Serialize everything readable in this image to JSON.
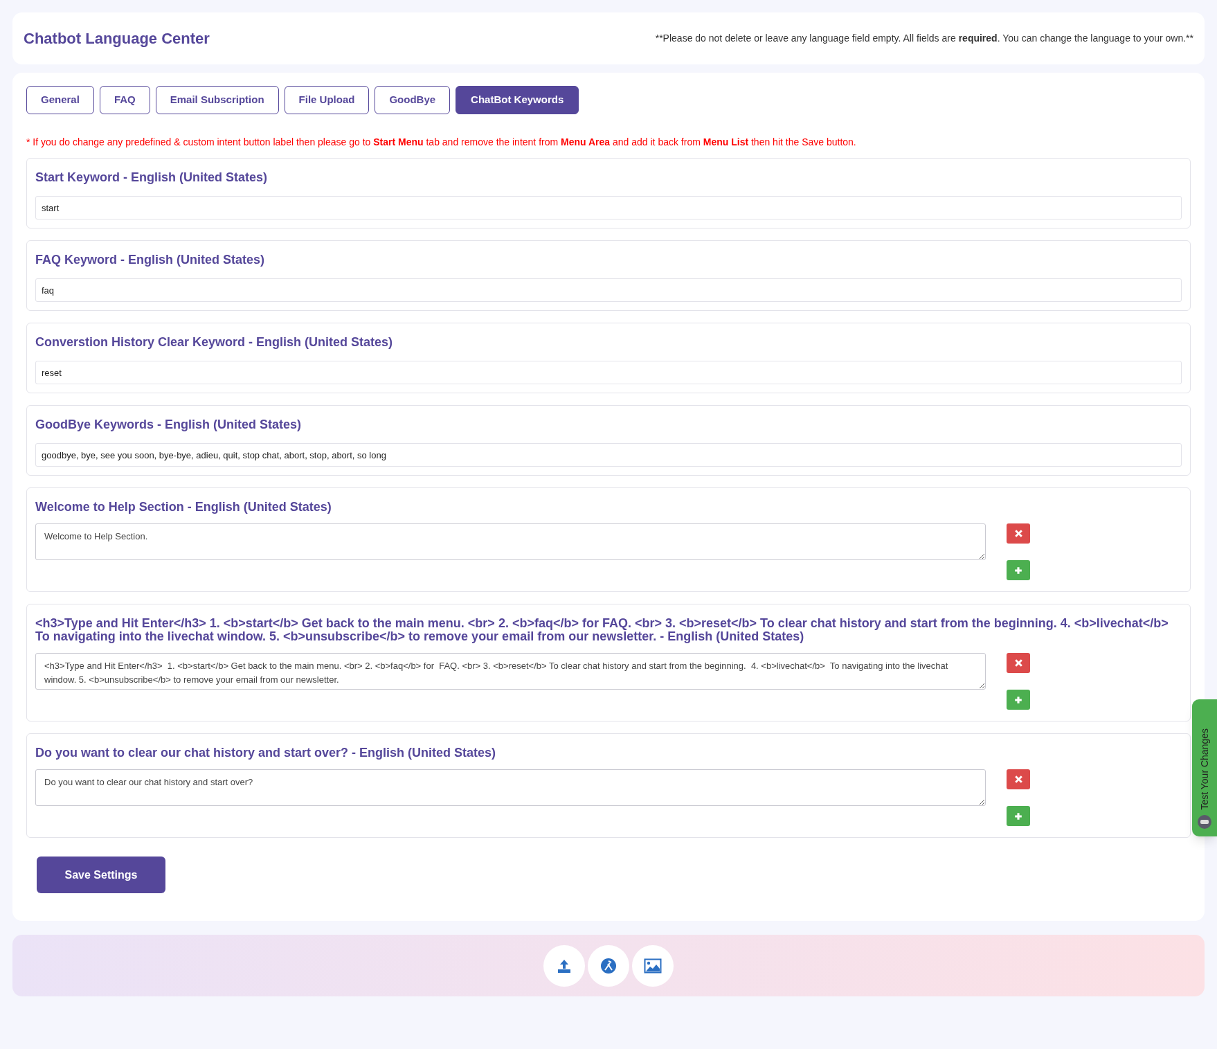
{
  "header": {
    "title": "Chatbot Language Center",
    "notice": {
      "before": "**Please do not delete or leave any language field empty. All fields are ",
      "bold": "required",
      "after": ". You can change the language to your own.**"
    }
  },
  "tabs": [
    {
      "label": "General",
      "selected": false
    },
    {
      "label": "FAQ",
      "selected": false
    },
    {
      "label": "Email Subscription",
      "selected": false
    },
    {
      "label": "File Upload",
      "selected": false
    },
    {
      "label": "GoodBye",
      "selected": false
    },
    {
      "label": "ChatBot Keywords",
      "selected": true
    }
  ],
  "warning": "* If you do change any predefined & custom intent button label then please go to **Start Menu** tab and remove the intent from **Menu Area** and add it back from **Menu List** then hit the Save button.",
  "sections": [
    {
      "kind": "input",
      "title": "Start Keyword - English (United States)",
      "value": "start"
    },
    {
      "kind": "input",
      "title": "FAQ Keyword - English (United States)",
      "value": "faq"
    },
    {
      "kind": "input",
      "title": "Converstion History Clear Keyword - English (United States)",
      "value": "reset"
    },
    {
      "kind": "input",
      "title": "GoodBye Keywords - English (United States)",
      "value": "goodbye, bye, see you soon, bye-bye, adieu, quit, stop chat, abort, stop, abort, so long"
    },
    {
      "kind": "textarea",
      "title": "Welcome to Help Section - English (United States)",
      "value": "Welcome to Help Section."
    },
    {
      "kind": "textarea",
      "title": "<h3>Type and Hit Enter</h3> 1. <b>start</b> Get back to the main menu. <br> 2. <b>faq</b> for FAQ. <br> 3. <b>reset</b> To clear chat history and start from the beginning. 4. <b>livechat</b> To navigating into the livechat window. 5. <b>unsubscribe</b> to remove your email from our newsletter. - English (United States)",
      "value": "<h3>Type and Hit Enter</h3>  1. <b>start</b> Get back to the main menu. <br> 2. <b>faq</b> for  FAQ. <br> 3. <b>reset</b> To clear chat history and start from the beginning.  4. <b>livechat</b>  To navigating into the livechat window. 5. <b>unsubscribe</b> to remove your email from our newsletter."
    },
    {
      "kind": "textarea",
      "title": "Do you want to clear our chat history and start over? - English (United States)",
      "value": "Do you want to clear our chat history and start over?"
    }
  ],
  "save_button": "Save Settings",
  "side_tab": "Test Your Changes",
  "footer_tools": [
    {
      "kind": "upload"
    },
    {
      "kind": "tools"
    },
    {
      "kind": "image"
    }
  ]
}
